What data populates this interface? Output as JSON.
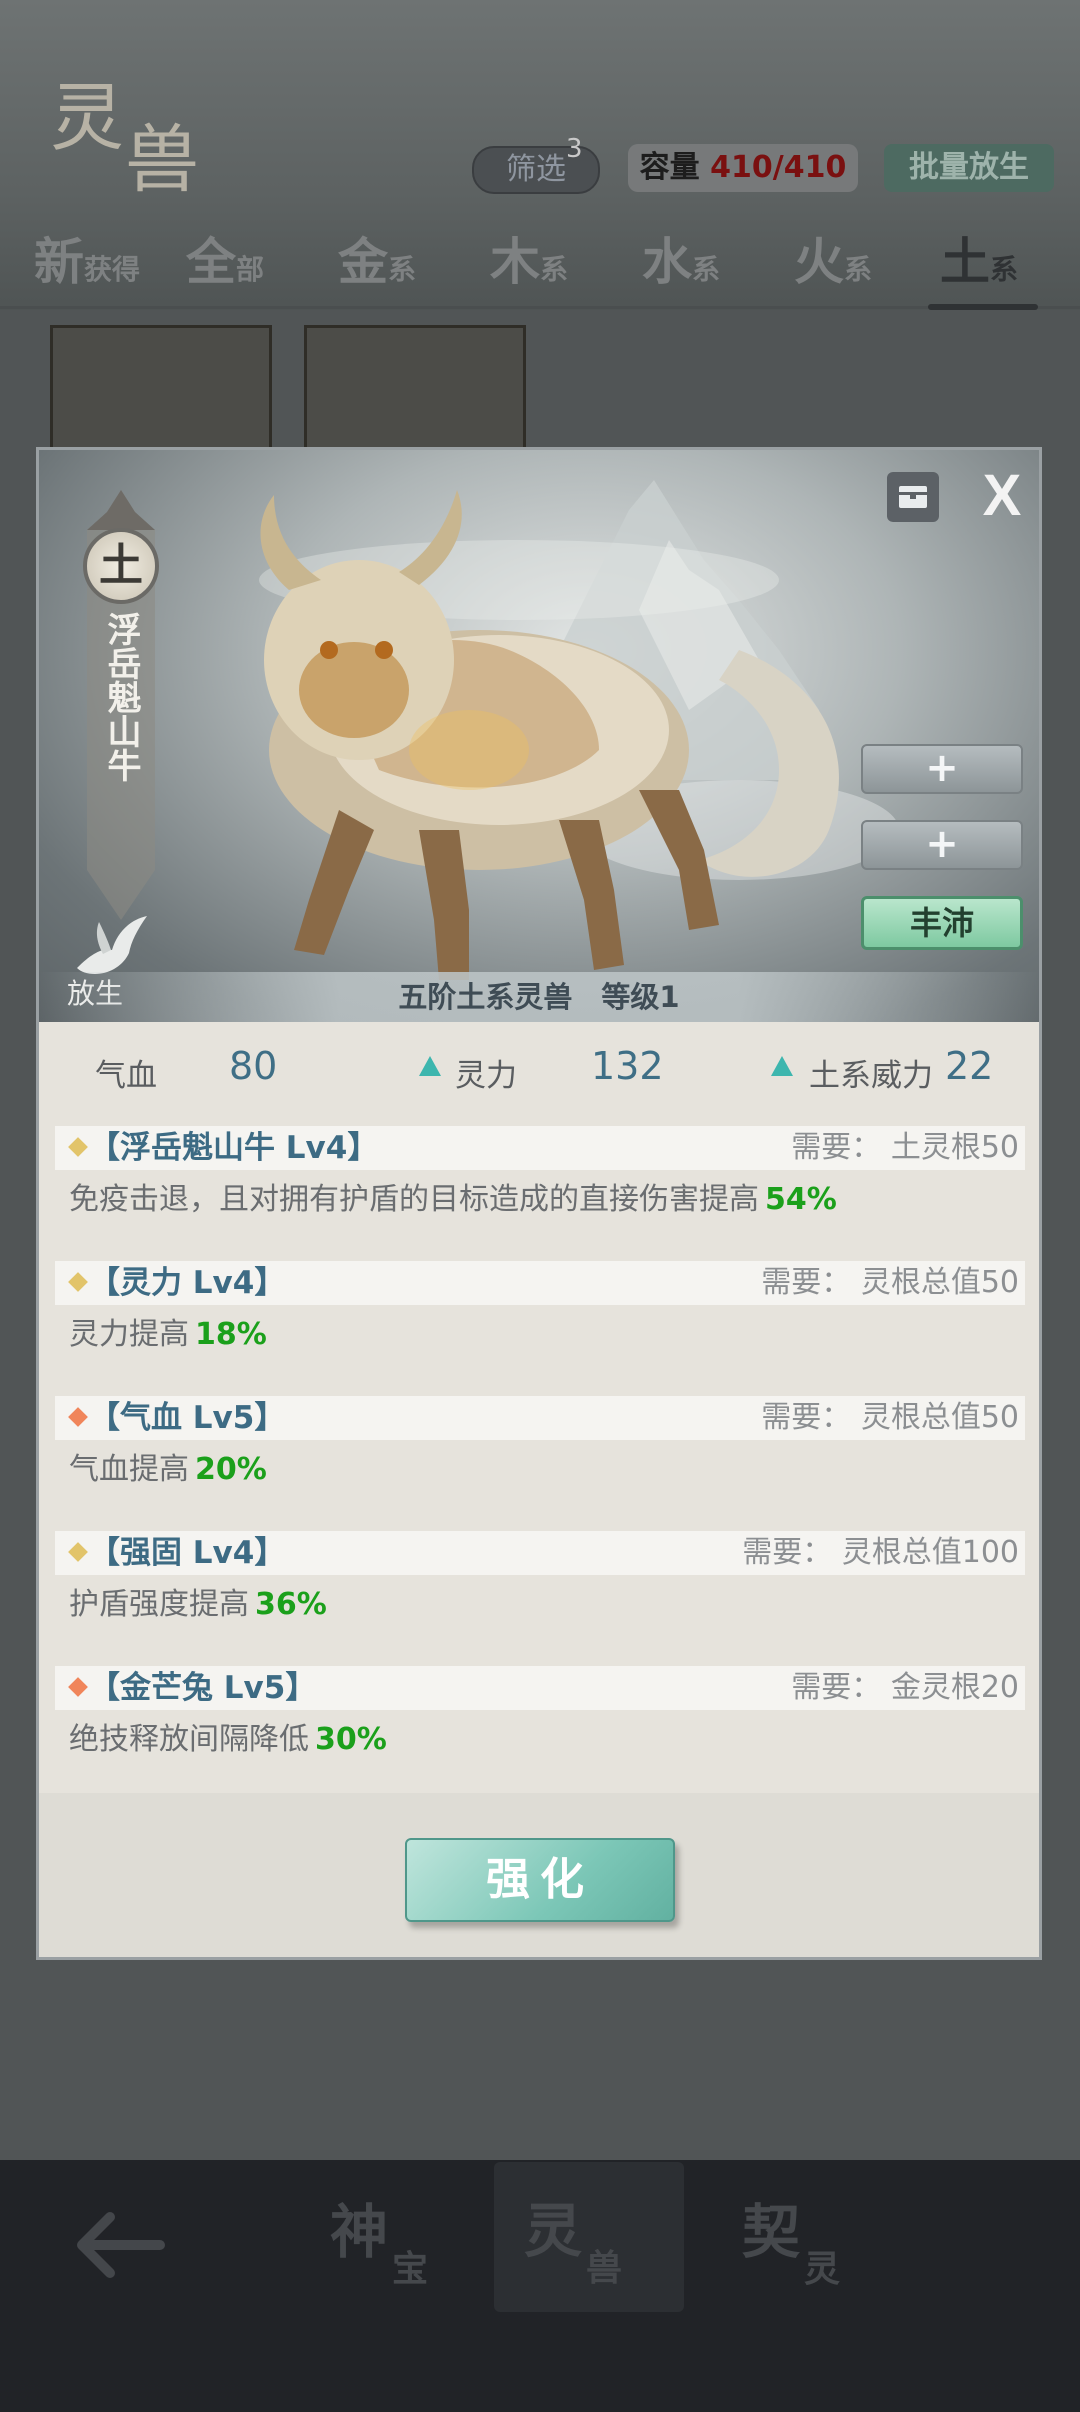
{
  "header": {
    "title_char1": "灵",
    "title_char2": "兽",
    "filter_label": "筛选",
    "filter_badge": "3",
    "capacity_label": "容量",
    "capacity_value": "410/410",
    "batch_release_label": "批量放生"
  },
  "tabs": [
    {
      "big": "新",
      "small": "获得"
    },
    {
      "big": "全",
      "small": "部"
    },
    {
      "big": "金",
      "small": "系"
    },
    {
      "big": "木",
      "small": "系"
    },
    {
      "big": "水",
      "small": "系"
    },
    {
      "big": "火",
      "small": "系"
    },
    {
      "big": "土",
      "small": "系",
      "active": true
    }
  ],
  "modal": {
    "element": "土",
    "beast_name": "浮岳魁山牛",
    "release_label": "放生",
    "close_label": "X",
    "slot1_label": "+",
    "slot2_label": "+",
    "abundant_label": "丰沛",
    "rank_text": "五阶土系灵兽　等级1",
    "stats": {
      "hp_label": "气血",
      "hp_value": "80",
      "spirit_label": "灵力",
      "spirit_value": "132",
      "earth_label": "土系威力",
      "earth_value": "22"
    },
    "skills": [
      {
        "title": "【浮岳魁山牛 Lv4】",
        "req": "需要：  土灵根50",
        "desc": "免疫击退，且对拥有护盾的目标造成的直接伤害提高",
        "pct": "54%",
        "color": "#e2c46a"
      },
      {
        "title": "【灵力 Lv4】",
        "req": "需要：  灵根总值50",
        "desc": "灵力提高",
        "pct": "18%",
        "color": "#e2c46a"
      },
      {
        "title": "【气血 Lv5】",
        "req": "需要：  灵根总值50",
        "desc": "气血提高",
        "pct": "20%",
        "color": "#f0855a"
      },
      {
        "title": "【强固 Lv4】",
        "req": "需要：  灵根总值100",
        "desc": "护盾强度提高",
        "pct": "36%",
        "color": "#e2c46a"
      },
      {
        "title": "【金芒兔 Lv5】",
        "req": "需要：  金灵根20",
        "desc": "绝技释放间隔降低",
        "pct": "30%",
        "color": "#f0855a"
      }
    ],
    "enhance_label": "强化"
  },
  "bottom_nav": [
    {
      "n1": "神",
      "n2": "宝"
    },
    {
      "n1": "灵",
      "n2": "兽",
      "active": true
    },
    {
      "n1": "契",
      "n2": "灵"
    }
  ]
}
